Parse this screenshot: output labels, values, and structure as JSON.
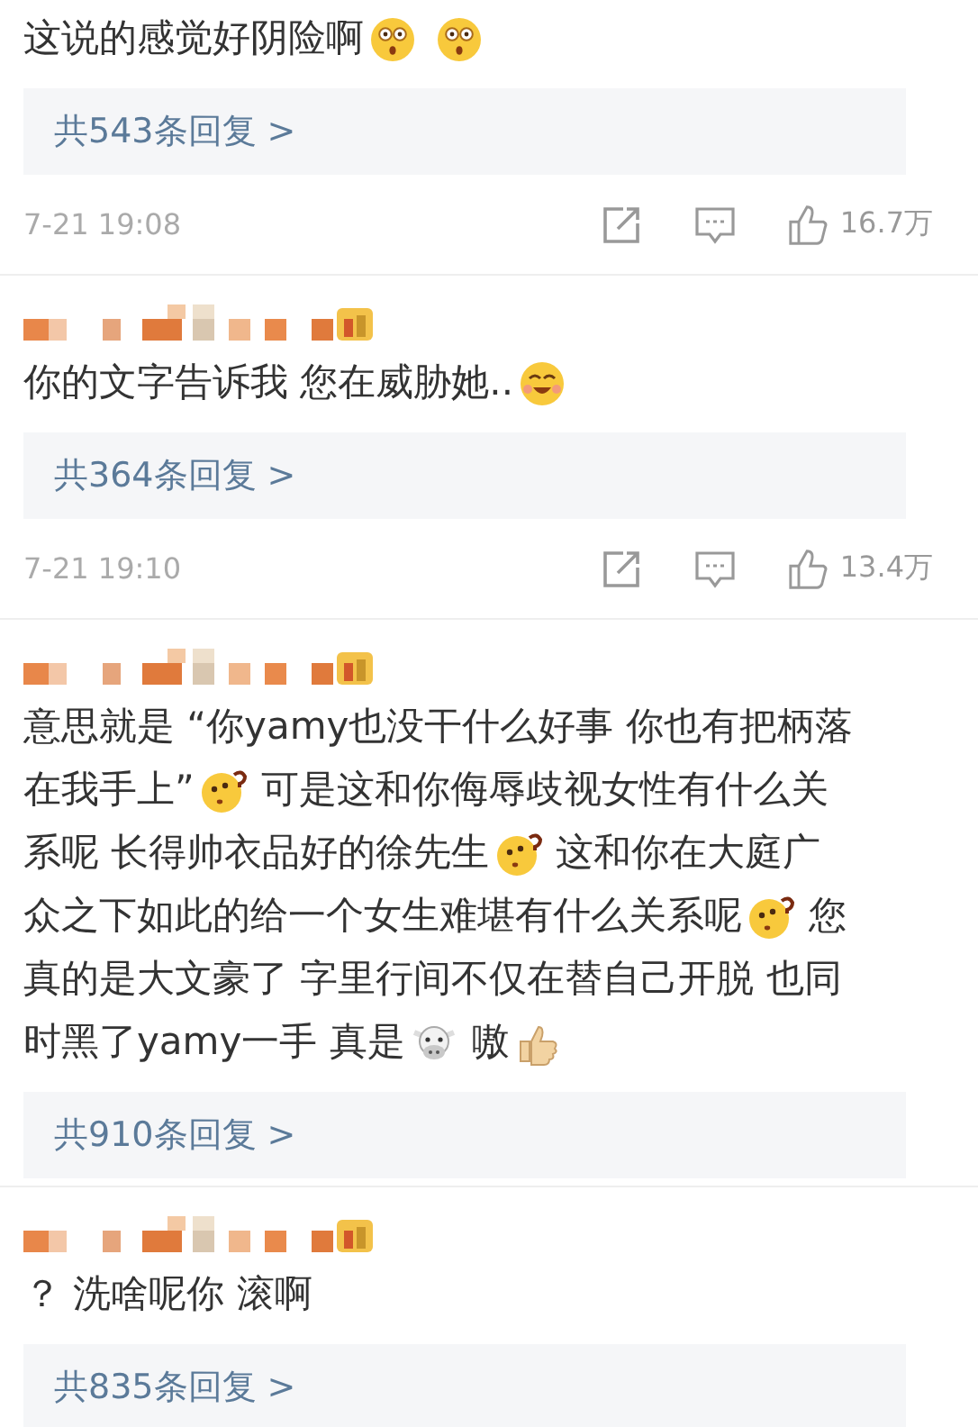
{
  "comments": [
    {
      "lines": [
        [
          {
            "kind": "text",
            "text": "这说的感觉好阴险啊"
          },
          {
            "kind": "shocked"
          },
          {
            "kind": "shocked"
          }
        ]
      ],
      "replies": "共543条回复 >",
      "footer": {
        "time": "7-21 19:08",
        "likes": "16.7万"
      }
    },
    {
      "author": {
        "kind": "pixelated"
      },
      "lines": [
        [
          {
            "kind": "text",
            "text": "你的文字告诉我 您在威胁她.."
          },
          {
            "kind": "grin"
          }
        ]
      ],
      "replies": "共364条回复 >",
      "footer": {
        "time": "7-21 19:10",
        "likes": "13.4万"
      }
    },
    {
      "author": {
        "kind": "pixelated"
      },
      "lines": [
        [
          {
            "kind": "text",
            "text": "意思就是 “你yamy也没干什么好事 你也有把柄落"
          }
        ],
        [
          {
            "kind": "text",
            "text": "在我手上”"
          },
          {
            "kind": "question"
          },
          {
            "kind": "text",
            "text": "可是这和你侮辱歧视女性有什么关"
          }
        ],
        [
          {
            "kind": "text",
            "text": "系呢 长得帅衣品好的徐先生"
          },
          {
            "kind": "question"
          },
          {
            "kind": "text",
            "text": "这和你在大庭广"
          }
        ],
        [
          {
            "kind": "text",
            "text": "众之下如此的给一个女生难堪有什么关系呢"
          },
          {
            "kind": "question"
          },
          {
            "kind": "text",
            "text": "您"
          }
        ],
        [
          {
            "kind": "text",
            "text": "真的是大文豪了 字里行间不仅在替自己开脱 也同"
          }
        ],
        [
          {
            "kind": "text",
            "text": "时黑了yamy一手 真是"
          },
          {
            "kind": "cow"
          },
          {
            "kind": "text",
            "text": "嗷"
          },
          {
            "kind": "thumb"
          }
        ]
      ],
      "replies": "共910条回复 >"
    },
    {
      "author": {
        "kind": "pixelated"
      },
      "lines": [
        [
          {
            "kind": "text",
            "text": "？ 洗啥呢你 滚啊"
          }
        ]
      ],
      "replies": "共835条回复 >"
    }
  ]
}
